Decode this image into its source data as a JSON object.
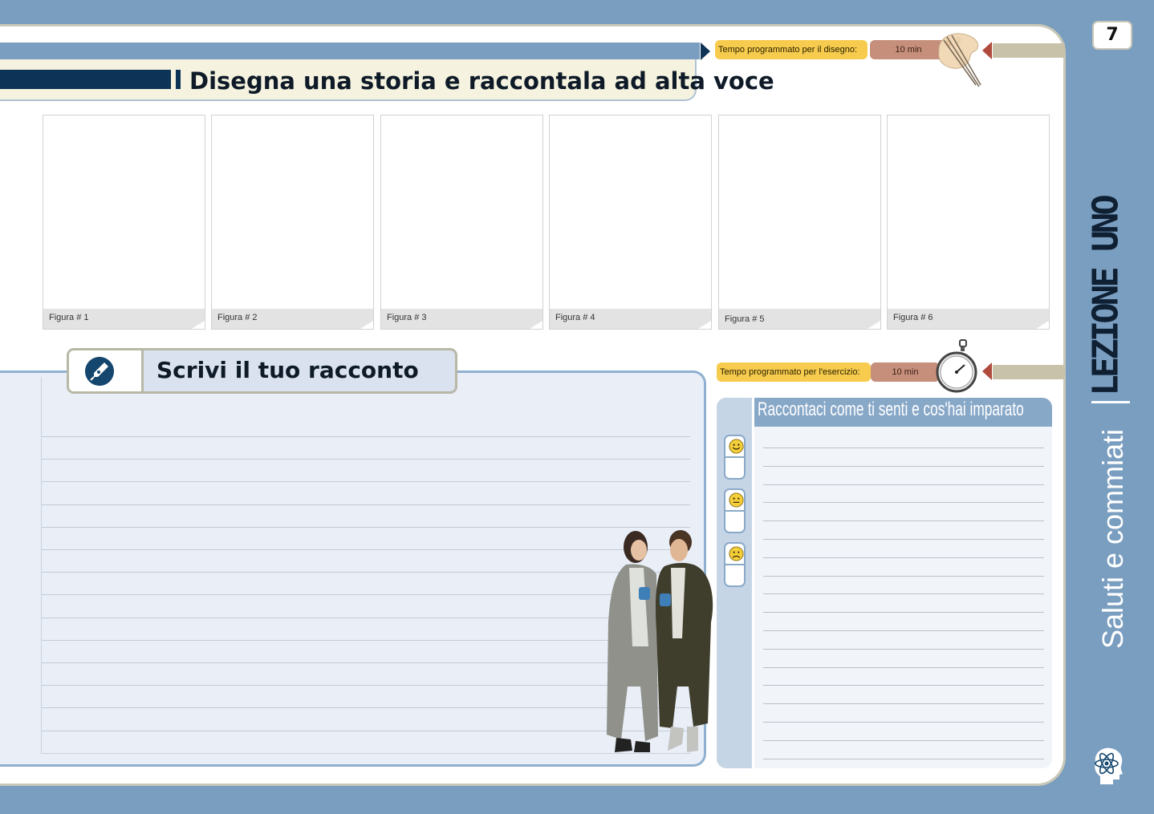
{
  "page_number": "7",
  "lesson": {
    "label": "LEZIONE UNO",
    "subtitle": "Saluti e commiati",
    "logo_icon": "brain-atom-icon"
  },
  "drawing_section": {
    "title": "Disegna una storia e raccontala ad alta voce",
    "time_label": "Tempo programmato per il disegno:",
    "time_value": "10 min",
    "icon": "palette-brushes-icon",
    "panels": [
      "Figura # 1",
      "Figura # 2",
      "Figura # 3",
      "Figura # 4",
      "Figura # 5",
      "Figura # 6"
    ]
  },
  "writing_section": {
    "title": "Scrivi il tuo racconto",
    "icon": "pen-nib-icon"
  },
  "feelings_section": {
    "time_label": "Tempo programmato per l'esercizio:",
    "time_value": "10 min",
    "timer_icon": "stopwatch-icon",
    "title": "Raccontaci come ti senti e cos'hai imparato",
    "moods": [
      "happy-face-icon",
      "neutral-face-icon",
      "sad-face-icon"
    ]
  },
  "colors": {
    "background_blue": "#7a9ec0",
    "navy": "#0d3356",
    "time_label_yellow": "#f7cb4d",
    "time_value_rose": "#c68f7b"
  }
}
